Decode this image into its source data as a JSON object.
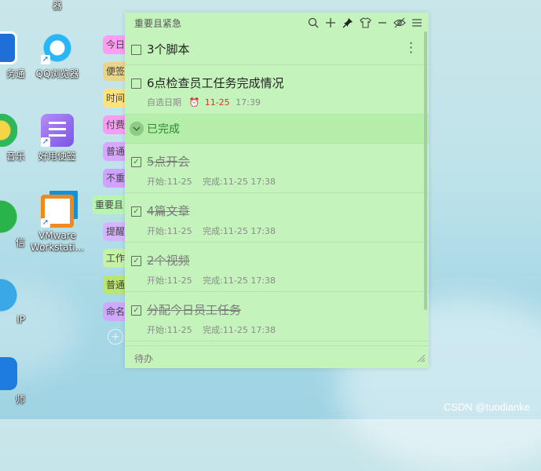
{
  "desktop": {
    "icons": [
      {
        "label": "务通",
        "name": "partial-app-icon"
      },
      {
        "label": "QQ浏览器",
        "name": "qq-browser-icon"
      },
      {
        "label": "音乐",
        "name": "partial-music-icon"
      },
      {
        "label": "好用便签",
        "name": "haoyong-notes-icon"
      },
      {
        "label": "信",
        "name": "partial-chat-icon"
      },
      {
        "label": "VMware\nWorkstati...",
        "name": "vmware-icon"
      },
      {
        "label": "IP",
        "name": "partial-ip-icon"
      },
      {
        "label": "师",
        "name": "partial-master-icon"
      },
      {
        "label": "器",
        "name": "partial-top-icon"
      }
    ]
  },
  "tabs": [
    {
      "label": "今日",
      "color": "#ff9cf3"
    },
    {
      "label": "便签",
      "color": "#e9d48a"
    },
    {
      "label": "时间",
      "color": "#ffe37a"
    },
    {
      "label": "付费",
      "color": "#f69cf3"
    },
    {
      "label": "普通",
      "color": "#d9a7ff"
    },
    {
      "label": "不重",
      "color": "#cfa3ff"
    },
    {
      "label": "重要且",
      "color": "#b7f5b0"
    },
    {
      "label": "提醒",
      "color": "#d6b4ff"
    },
    {
      "label": "工作",
      "color": "#c6f2a3"
    },
    {
      "label": "普通",
      "color": "#b8e66e"
    },
    {
      "label": "命名",
      "color": "#d1a8ff"
    }
  ],
  "note": {
    "title": "重要且紧急",
    "header_icons": [
      "search-icon",
      "plus-icon",
      "pin-icon",
      "shirt-icon",
      "minimize-icon",
      "eye-off-icon",
      "menu-icon"
    ],
    "pending": [
      {
        "title": "3个脚本",
        "more": "⋮"
      },
      {
        "title": "6点检查员工任务完成情况",
        "date_label": "自选日期",
        "alarm_date": "11-25",
        "alarm_time": "17:39"
      }
    ],
    "done_section": "已完成",
    "done": [
      {
        "title": "5点开会",
        "start": "开始:11-25",
        "finish": "完成:11-25 17:38"
      },
      {
        "title": "4篇文章",
        "start": "开始:11-25",
        "finish": "完成:11-25 17:38"
      },
      {
        "title": "2个视频",
        "start": "开始:11-25",
        "finish": "完成:11-25 17:38"
      },
      {
        "title": "分配今日员工任务",
        "start": "开始:11-25",
        "finish": "完成:11-25 17:38"
      }
    ],
    "footer": "待办"
  },
  "watermark": "CSDN @tuodianke"
}
